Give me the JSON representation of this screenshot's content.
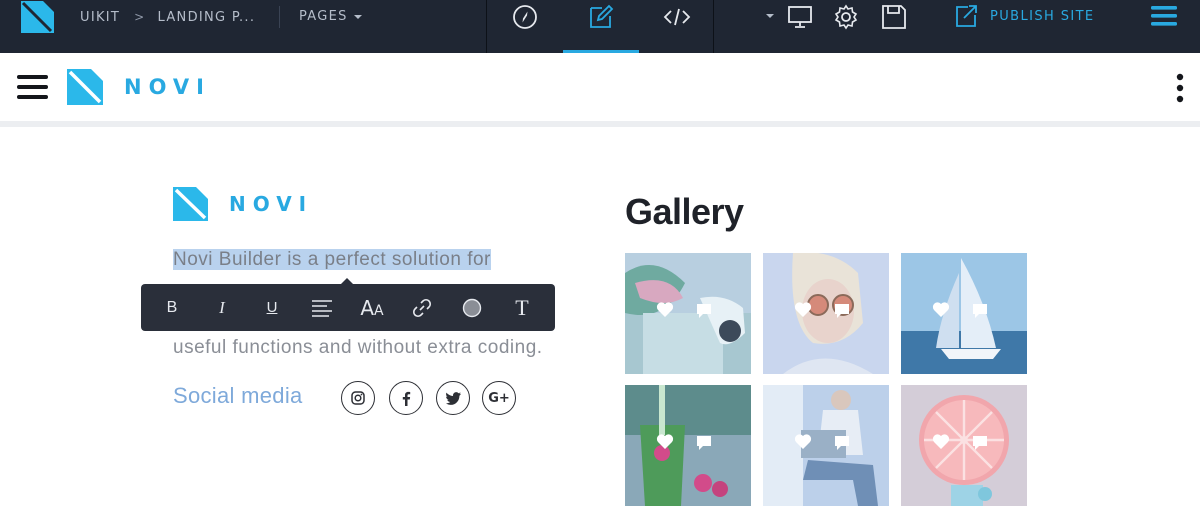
{
  "editor": {
    "breadcrumb": [
      "UIKIT",
      "LANDING P..."
    ],
    "pages_label": "PAGES",
    "publish_label": "PUBLISH SITE",
    "accent_color": "#29a9e1",
    "bar_color": "#1f2633",
    "modes": [
      {
        "name": "navigate",
        "icon": "compass-icon"
      },
      {
        "name": "design",
        "icon": "pencil-icon",
        "active": true
      },
      {
        "name": "code",
        "icon": "code-icon"
      }
    ],
    "tools": [
      "device-preview-icon",
      "settings-icon",
      "save-icon"
    ]
  },
  "site": {
    "brand": "NOVI",
    "about_lines": [
      "Novi Builder is a perfect solution for",
      "",
      "useful functions and without extra coding."
    ],
    "social_label": "Social media",
    "social_icons": [
      "instagram-icon",
      "facebook-icon",
      "twitter-icon",
      "google-plus-icon"
    ],
    "gallery_title": "Gallery"
  },
  "text_toolbar": {
    "buttons": [
      {
        "name": "bold",
        "glyph": "B"
      },
      {
        "name": "italic",
        "glyph": "I"
      },
      {
        "name": "underline",
        "glyph": "U"
      },
      {
        "name": "align",
        "glyph": "align-left-icon"
      },
      {
        "name": "font-size",
        "glyph": "AA"
      },
      {
        "name": "link",
        "glyph": "link-icon"
      },
      {
        "name": "color",
        "glyph": "color-circle-icon"
      },
      {
        "name": "text-style",
        "glyph": "T"
      }
    ]
  }
}
